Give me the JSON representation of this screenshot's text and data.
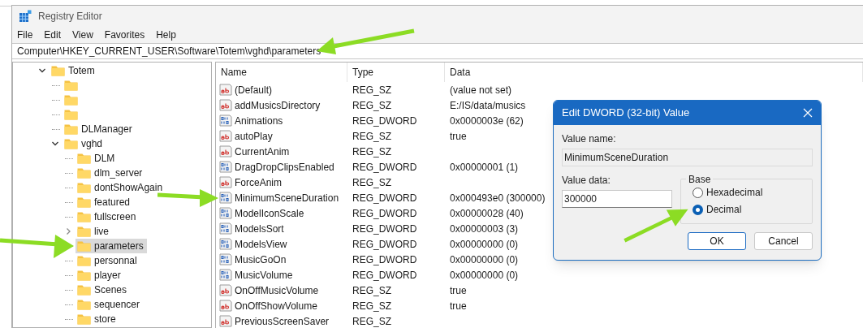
{
  "window": {
    "title": "Registry Editor"
  },
  "menu": [
    "File",
    "Edit",
    "View",
    "Favorites",
    "Help"
  ],
  "address": "Computer\\HKEY_CURRENT_USER\\Software\\Totem\\vghd\\parameters",
  "tree": [
    {
      "label": "Totem",
      "expanded": true,
      "selected": false,
      "children": [
        {
          "selected": false
        },
        {
          "selected": false
        },
        {
          "selected": false
        },
        {
          "label": "DLManager",
          "selected": false
        },
        {
          "label": "vghd",
          "expanded": true,
          "selected": false,
          "children": [
            {
              "label": "DLM",
              "selected": false
            },
            {
              "label": "dlm_server",
              "selected": false
            },
            {
              "label": "dontShowAgain",
              "selected": false
            },
            {
              "label": "featured",
              "selected": false
            },
            {
              "label": "fullscreen",
              "selected": false
            },
            {
              "label": "live",
              "expanded": false,
              "selected": false
            },
            {
              "label": "parameters",
              "selected": true
            },
            {
              "label": "personnal",
              "selected": false
            },
            {
              "label": "player",
              "selected": false
            },
            {
              "label": "Scenes",
              "selected": false
            },
            {
              "label": "sequencer",
              "selected": false
            },
            {
              "label": "store",
              "selected": false
            }
          ]
        }
      ]
    }
  ],
  "values": {
    "columns": [
      "Name",
      "Type",
      "Data"
    ],
    "rows": [
      {
        "kind": "string",
        "name": "(Default)",
        "type": "REG_SZ",
        "data": "(value not set)"
      },
      {
        "kind": "string",
        "name": "addMusicsDirectory",
        "type": "REG_SZ",
        "data": "E:/IS/data/musics"
      },
      {
        "kind": "dword",
        "name": "Animations",
        "type": "REG_DWORD",
        "data": "0x0000003e (62)"
      },
      {
        "kind": "string",
        "name": "autoPlay",
        "type": "REG_SZ",
        "data": "true"
      },
      {
        "kind": "string",
        "name": "CurrentAnim",
        "type": "REG_SZ"
      },
      {
        "kind": "dword",
        "name": "DragDropClipsEnabled",
        "type": "REG_DWORD",
        "data": "0x00000001 (1)"
      },
      {
        "kind": "string",
        "name": "ForceAnim",
        "type": "REG_SZ"
      },
      {
        "kind": "dword",
        "name": "MinimumSceneDuration",
        "type": "REG_DWORD",
        "data": "0x000493e0 (300000)"
      },
      {
        "kind": "dword",
        "name": "ModelIconScale",
        "type": "REG_DWORD",
        "data": "0x00000028 (40)"
      },
      {
        "kind": "dword",
        "name": "ModelsSort",
        "type": "REG_DWORD",
        "data": "0x00000003 (3)"
      },
      {
        "kind": "dword",
        "name": "ModelsView",
        "type": "REG_DWORD",
        "data": "0x00000000 (0)"
      },
      {
        "kind": "dword",
        "name": "MusicGoOn",
        "type": "REG_DWORD",
        "data": "0x00000000 (0)"
      },
      {
        "kind": "dword",
        "name": "MusicVolume",
        "type": "REG_DWORD",
        "data": "0x00000000 (0)"
      },
      {
        "kind": "string",
        "name": "OnOffMusicVolume",
        "type": "REG_SZ",
        "data": "true"
      },
      {
        "kind": "string",
        "name": "OnOffShowVolume",
        "type": "REG_SZ",
        "data": "true"
      },
      {
        "kind": "string",
        "name": "PreviousScreenSaver",
        "type": "REG_SZ"
      }
    ]
  },
  "dialog": {
    "title": "Edit DWORD (32-bit) Value",
    "name_label": "Value name:",
    "name_value": "MinimumSceneDuration",
    "data_label": "Value data:",
    "data_value": "300000",
    "base_label": "Base",
    "bases": [
      {
        "label": "Hexadecimal",
        "selected": false
      },
      {
        "label": "Decimal",
        "selected": true
      }
    ],
    "buttons": [
      "OK",
      "Cancel"
    ]
  }
}
